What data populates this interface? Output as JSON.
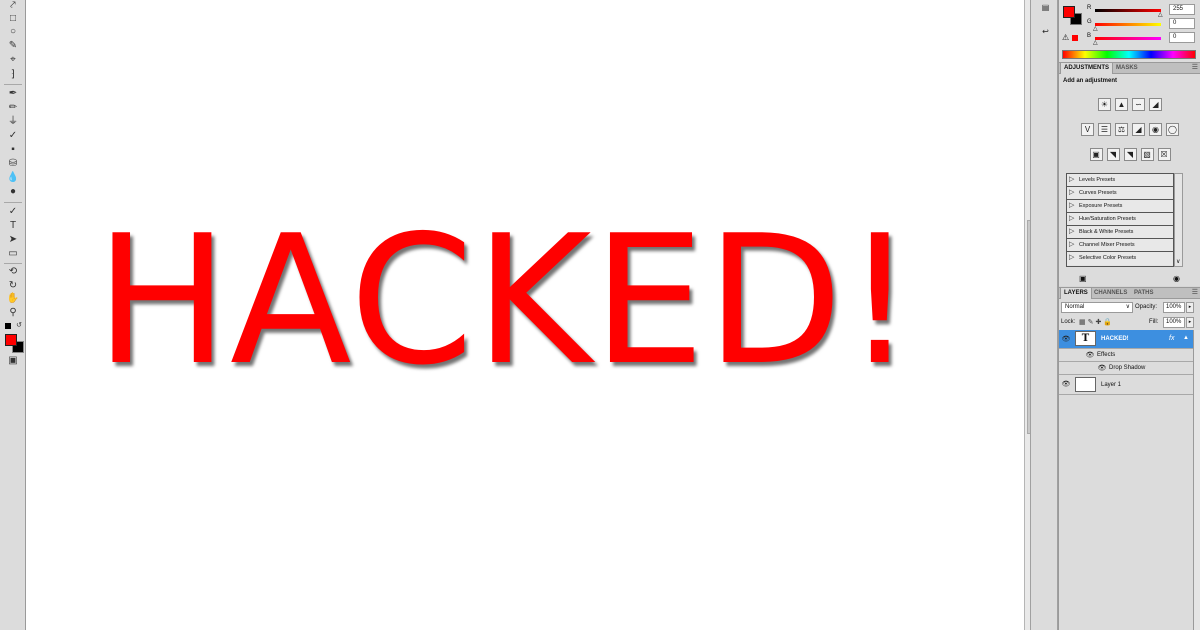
{
  "canvas": {
    "text": "HACKED!",
    "text_color": "#ff0000",
    "background": "#ffffff"
  },
  "tools": {
    "items": [
      "move-tool-icon",
      "marquee-tool-icon",
      "lasso-tool-icon",
      "quick-selection-tool-icon",
      "crop-tool-icon",
      "eyedropper-tool-icon",
      "spot-healing-tool-icon",
      "brush-tool-icon",
      "clone-stamp-tool-icon",
      "history-brush-tool-icon",
      "eraser-tool-icon",
      "paint-bucket-tool-icon",
      "blur-tool-icon",
      "dodge-tool-icon",
      "pen-tool-icon",
      "type-tool-icon",
      "path-selection-tool-icon",
      "shape-tool-icon",
      "3d-rotate-tool-icon",
      "3d-orbit-tool-icon",
      "hand-tool-icon",
      "zoom-tool-icon"
    ],
    "type_tool_glyph": "T",
    "foreground_color": "#ff0000",
    "background_color": "#000000"
  },
  "color_panel": {
    "foreground_color": "#ff0000",
    "background_color": "#000000",
    "channels": [
      {
        "label": "R",
        "value": "255"
      },
      {
        "label": "G",
        "value": "0"
      },
      {
        "label": "B",
        "value": "0"
      }
    ],
    "warning_icon": "⚠"
  },
  "adjustments_panel": {
    "tabs": [
      "ADJUSTMENTS",
      "MASKS"
    ],
    "title": "Add an adjustment",
    "presets": [
      "Levels Presets",
      "Curves Presets",
      "Exposure Presets",
      "Hue/Saturation Presets",
      "Black & White Presets",
      "Channel Mixer Presets",
      "Selective Color Presets"
    ]
  },
  "layers_panel": {
    "tabs": [
      "LAYERS",
      "CHANNELS",
      "PATHS"
    ],
    "blend_mode": "Normal",
    "opacity_label": "Opacity:",
    "opacity_value": "100%",
    "fill_label": "Fill:",
    "fill_value": "100%",
    "lock_label": "Lock:",
    "layers": [
      {
        "name": "HACKED!",
        "type": "text",
        "fx": "fx",
        "selected": true
      },
      {
        "name": "Effects",
        "type": "effects"
      },
      {
        "name": "Drop Shadow",
        "type": "effect"
      },
      {
        "name": "Layer 1",
        "type": "pixel"
      }
    ],
    "selected_color": "#3d8fe0"
  }
}
